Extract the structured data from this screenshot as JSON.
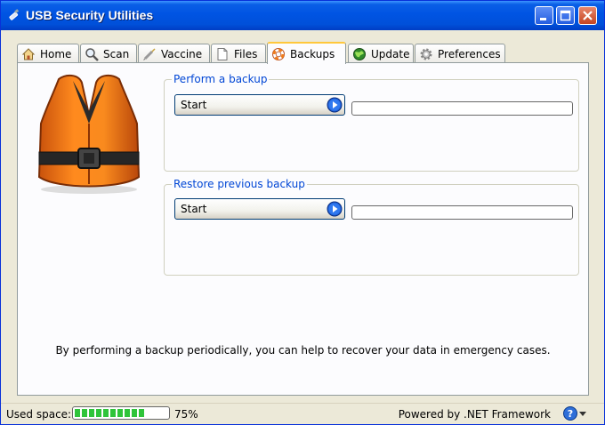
{
  "window": {
    "title": "USB Security Utilities"
  },
  "tabs": [
    {
      "label": "Home",
      "icon": "home-icon"
    },
    {
      "label": "Scan",
      "icon": "magnifier-icon"
    },
    {
      "label": "Vaccine",
      "icon": "syringe-icon"
    },
    {
      "label": "Files",
      "icon": "document-icon"
    },
    {
      "label": "Backups",
      "icon": "lifebuoy-icon",
      "active": true
    },
    {
      "label": "Update",
      "icon": "globe-icon"
    },
    {
      "label": "Preferences",
      "icon": "gear-icon"
    }
  ],
  "backup": {
    "group_label": "Perform a backup",
    "start_label": "Start",
    "progress": 0
  },
  "restore": {
    "group_label": "Restore previous backup",
    "start_label": "Start",
    "progress": 0
  },
  "info_text": "By performing a backup periodically, you can help to recover your data in emergency cases.",
  "statusbar": {
    "used_space_label": "Used space:",
    "used_space_percent": "75%",
    "used_space_value": 0.75,
    "powered_by": "Powered by .NET Framework"
  },
  "colors": {
    "title_bar": "#0054e3",
    "group_label": "#0046d5",
    "progress_fill": "#2fc43a",
    "active_tab_accent": "#ffc83c"
  }
}
